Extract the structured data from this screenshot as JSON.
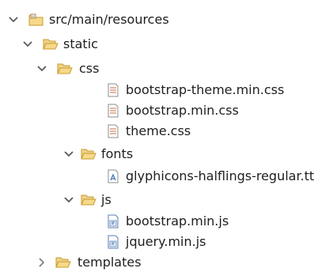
{
  "tree": {
    "items": [
      {
        "label": "src/main/resources",
        "type": "source-folder",
        "expanded": true
      },
      {
        "label": "static",
        "type": "folder",
        "expanded": true
      },
      {
        "label": "css",
        "type": "folder",
        "expanded": true
      },
      {
        "label": "bootstrap-theme.min.css",
        "type": "css-file"
      },
      {
        "label": "bootstrap.min.css",
        "type": "css-file"
      },
      {
        "label": "theme.css",
        "type": "css-file"
      },
      {
        "label": "fonts",
        "type": "folder",
        "expanded": true
      },
      {
        "label": "glyphicons-halflings-regular.tt",
        "type": "font-file"
      },
      {
        "label": "js",
        "type": "folder",
        "expanded": true
      },
      {
        "label": "bootstrap.min.js",
        "type": "js-file"
      },
      {
        "label": "jquery.min.js",
        "type": "js-file"
      },
      {
        "label": "templates",
        "type": "folder",
        "expanded": false
      }
    ]
  },
  "colors": {
    "folder_fill": "#f6d98a",
    "folder_stroke": "#c99b2c",
    "chevron": "#5a5a5a",
    "text": "#1e1e1e"
  }
}
